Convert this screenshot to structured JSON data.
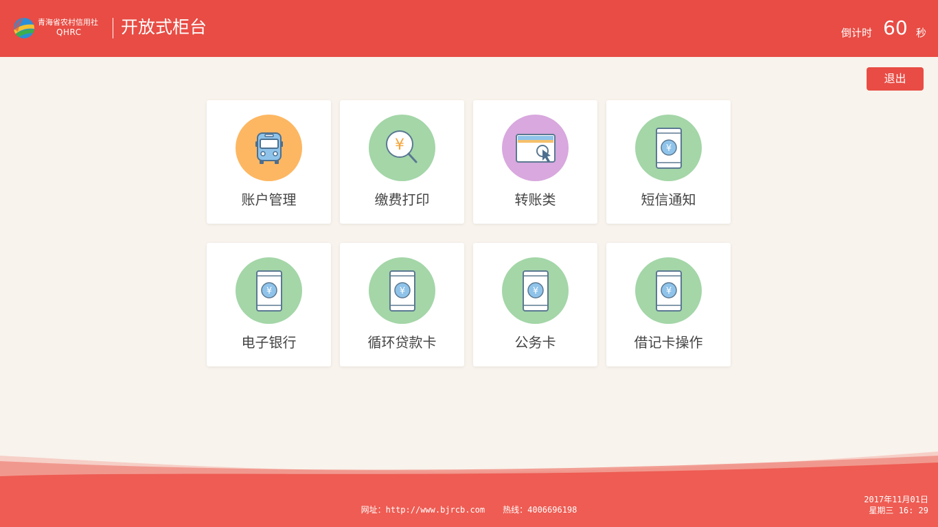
{
  "header": {
    "org_name": "青海省农村信用社",
    "org_abbr": "QHRC",
    "app_title": "开放式柜台",
    "countdown_label": "倒计时",
    "countdown_value": "60",
    "countdown_unit": "秒"
  },
  "logout_label": "退出",
  "tiles": [
    {
      "label": "账户管理",
      "icon": "bus-icon",
      "color": "#fdb762"
    },
    {
      "label": "缴费打印",
      "icon": "yen-search-icon",
      "color": "#a4d6a8"
    },
    {
      "label": "转账类",
      "icon": "card-click-icon",
      "color": "#d8a8de"
    },
    {
      "label": "短信通知",
      "icon": "phone-yen-icon",
      "color": "#a4d6a8"
    },
    {
      "label": "电子银行",
      "icon": "phone-yen-icon",
      "color": "#a4d6a8"
    },
    {
      "label": "循环贷款卡",
      "icon": "phone-yen-icon",
      "color": "#a4d6a8"
    },
    {
      "label": "公务卡",
      "icon": "phone-yen-icon",
      "color": "#a4d6a8"
    },
    {
      "label": "借记卡操作",
      "icon": "phone-yen-icon",
      "color": "#a4d6a8"
    }
  ],
  "footer": {
    "website": "网址：http://www.bjrcb.com",
    "hotline": "热线：4006696198",
    "date": "2017年11月01日",
    "weekday_time": "星期三 16: 29"
  },
  "colors": {
    "brand": "#e84c44",
    "background": "#f8f3ec"
  }
}
